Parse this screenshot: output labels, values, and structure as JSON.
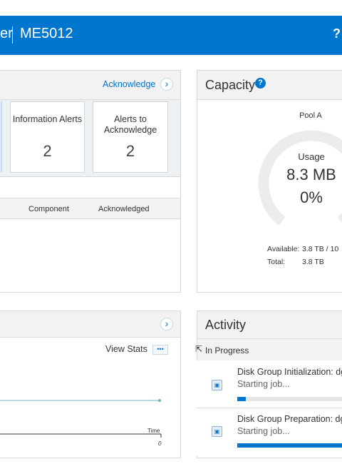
{
  "header": {
    "title_fragment": "er",
    "model": "ME5012",
    "help_label": "?"
  },
  "alerts": {
    "acknowledge_label": "Acknowledge",
    "cards": [
      {
        "label": "Information Alerts",
        "count": "2"
      },
      {
        "label": "Alerts to Acknowledge",
        "count": "2"
      }
    ],
    "columns": [
      "Component",
      "Acknowledged"
    ]
  },
  "capacity": {
    "title": "Capacity",
    "pool": "Pool A",
    "usage_label": "Usage",
    "usage_value": "8.3 MB",
    "usage_percent": "0%",
    "available_label": "Available:",
    "available_value": "3.8 TB / 10",
    "total_label": "Total:",
    "total_value": "3.8 TB"
  },
  "performance": {
    "view_stats_label": "View Stats",
    "more_label": "•••",
    "time_label": "Time",
    "time_zero": "0"
  },
  "activity": {
    "title": "Activity",
    "section": "In Progress",
    "items": [
      {
        "title": "Disk Group Initialization: dg",
        "status": "Starting job...",
        "progress": 0.08
      },
      {
        "title": "Disk Group Preparation: dgA",
        "status": "Starting job...",
        "progress": 1.0
      }
    ]
  },
  "colors": {
    "accent": "#0076ce",
    "panel_header": "#f2f2f2",
    "border": "#d8d8d8"
  }
}
